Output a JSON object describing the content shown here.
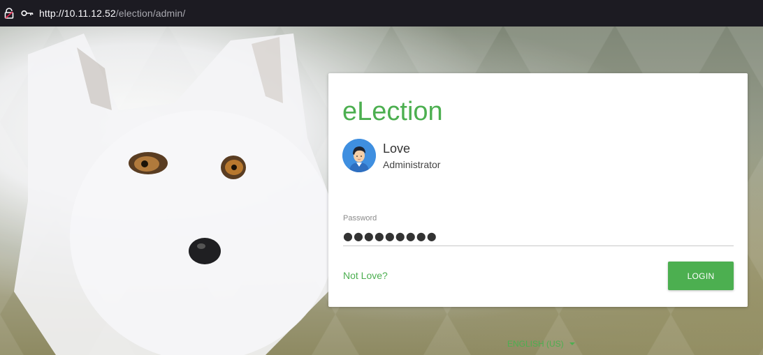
{
  "browser": {
    "url_host": "http://10.11.12.52",
    "url_path": "/election/admin/"
  },
  "login": {
    "brand": "eLection",
    "user_name": "Love",
    "user_role": "Administrator",
    "password_label": "Password",
    "password_value": "●●●●●●●●●",
    "not_user_link": "Not Love?",
    "login_button": "LOGIN"
  },
  "footer": {
    "language": "ENGLISH (US)"
  },
  "colors": {
    "accent": "#4caf50",
    "avatar_bg": "#3f8fe0"
  },
  "icons": [
    "lock-warning-icon",
    "key-icon",
    "avatar-icon",
    "caret-down-icon"
  ]
}
